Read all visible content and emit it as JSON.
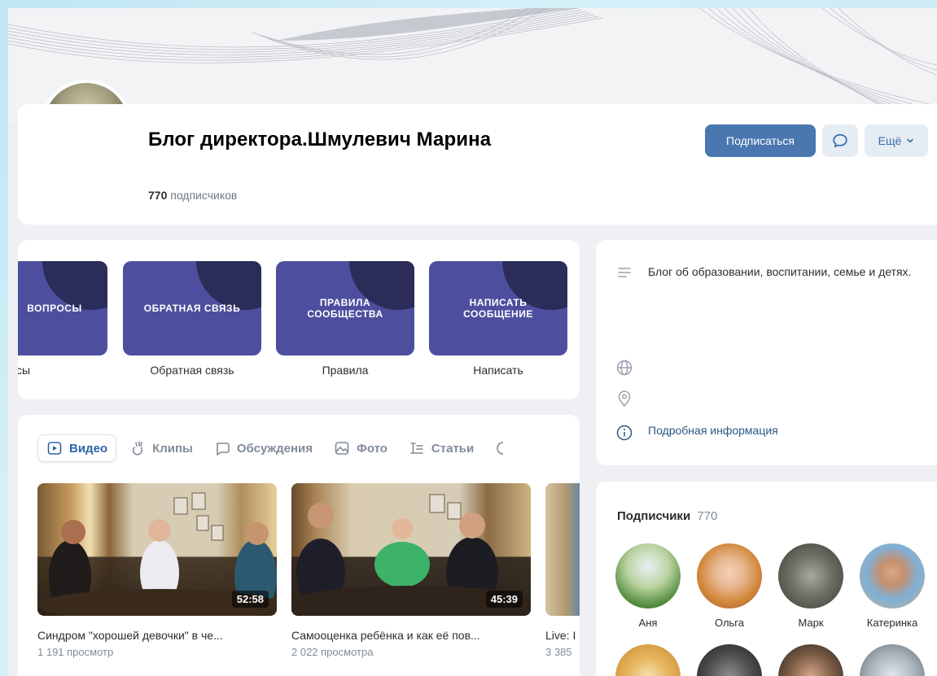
{
  "header": {
    "title": "Блог директора.Шмулевич Марина",
    "subscribers_number": "770",
    "subscribers_word": "подписчиков",
    "subscribe_label": "Подписаться",
    "more_label": "Ещё"
  },
  "menu": {
    "tiles": [
      {
        "tile_text": "ВОПРОСЫ",
        "label": "просы"
      },
      {
        "tile_text": "ОБРАТНАЯ СВЯЗЬ",
        "label": "Обратная связь"
      },
      {
        "tile_text_line1": "ПРАВИЛА",
        "tile_text_line2": "СООБЩЕСТВА",
        "label": "Правила"
      },
      {
        "tile_text_line1": "НАПИСАТЬ",
        "tile_text_line2": "СООБЩЕНИЕ",
        "label": "Написать"
      }
    ],
    "tile_color": "#4d4f9e"
  },
  "info": {
    "description": "Блог об образовании, воспитании, семье и детях.",
    "details_link": "Подробная информация"
  },
  "tabs": [
    {
      "label": "Видео",
      "icon": "video-icon",
      "active": true
    },
    {
      "label": "Клипы",
      "icon": "clips-icon",
      "active": false
    },
    {
      "label": "Обсуждения",
      "icon": "discussion-icon",
      "active": false
    },
    {
      "label": "Фото",
      "icon": "photo-icon",
      "active": false
    },
    {
      "label": "Статьи",
      "icon": "articles-icon",
      "active": false
    }
  ],
  "videos": [
    {
      "title": "Синдром \"хорошей девочки\" в че...",
      "views": "1 191 просмотр",
      "duration": "52:58"
    },
    {
      "title": "Самооценка ребёнка и как её пов...",
      "views": "2 022 просмотра",
      "duration": "45:39"
    },
    {
      "title": "Live: I",
      "views": "3 385",
      "duration": ""
    }
  ],
  "subscribers": {
    "title": "Подписчики",
    "count": "770",
    "people": [
      {
        "name": "Аня"
      },
      {
        "name": "Ольга"
      },
      {
        "name": "Марк"
      },
      {
        "name": "Катеринка"
      }
    ]
  },
  "colors": {
    "primary_button": "#4a77b0",
    "secondary_button": "#e6ecf3",
    "link": "#2a5885",
    "muted_text": "#818c99"
  }
}
